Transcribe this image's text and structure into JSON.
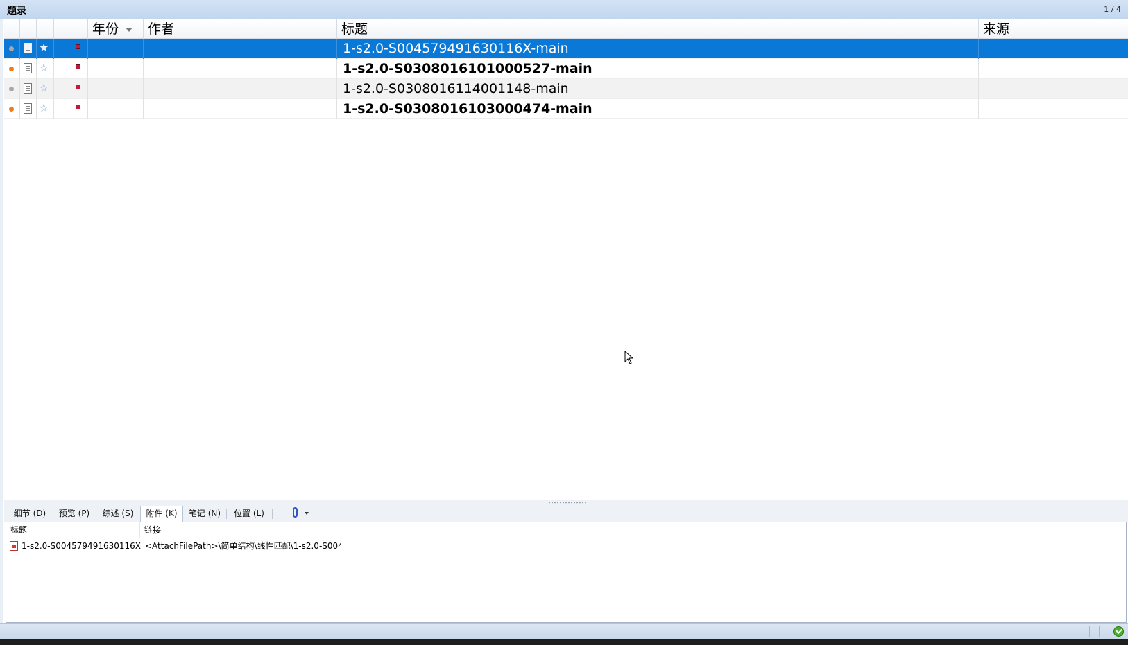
{
  "window": {
    "title": "题录",
    "record_count": "1 / 4"
  },
  "grid": {
    "columns": {
      "year": "年份",
      "author": "作者",
      "title": "标题",
      "source": "来源"
    },
    "rows": [
      {
        "read": "read",
        "title": "1-s2.0-S004579491630116X-main",
        "year": "",
        "author": "",
        "source": ""
      },
      {
        "read": "unread",
        "title": "1-s2.0-S0308016101000527-main",
        "year": "",
        "author": "",
        "source": ""
      },
      {
        "read": "read",
        "title": "1-s2.0-S0308016114001148-main",
        "year": "",
        "author": "",
        "source": ""
      },
      {
        "read": "unread",
        "title": "1-s2.0-S0308016103000474-main",
        "year": "",
        "author": "",
        "source": ""
      }
    ],
    "icons": {
      "read_dot": "grey-dot-icon",
      "unread_dot": "orange-dot-icon",
      "doc": "document-icon",
      "star": "star-icon",
      "flag": "red-flag-icon"
    }
  },
  "tabs": [
    {
      "label": "细节 (D)"
    },
    {
      "label": "预览 (P)"
    },
    {
      "label": "综述 (S)"
    },
    {
      "label": "附件 (K)",
      "active": true
    },
    {
      "label": "笔记 (N)"
    },
    {
      "label": "位置 (L)"
    }
  ],
  "attachments": {
    "columns": {
      "title": "标题",
      "link": "链接"
    },
    "rows": [
      {
        "title": "1-s2.0-S004579491630116X-...",
        "link": "<AttachFilePath>\\简单结构\\线性匹配\\1-s2.0-S004..."
      }
    ]
  },
  "colors": {
    "selection": "#0a78d7",
    "unread_dot": "#f07a17",
    "read_dot": "#a8a8a8",
    "flag": "#c21a3a"
  }
}
